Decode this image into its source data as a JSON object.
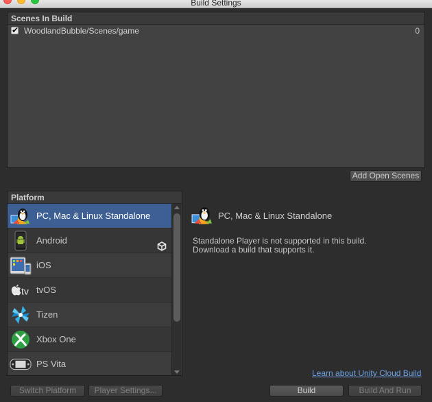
{
  "window": {
    "title": "Build Settings"
  },
  "scenes": {
    "header": "Scenes In Build",
    "items": [
      {
        "path": "WoodlandBubble/Scenes/game",
        "index": "0",
        "checked": true
      }
    ],
    "add_open_scenes_label": "Add Open Scenes"
  },
  "platform": {
    "header": "Platform",
    "items": [
      {
        "label": "PC, Mac & Linux Standalone",
        "icon": "linux-penguin-icon",
        "selected": true
      },
      {
        "label": "Android",
        "icon": "android-icon",
        "selected": false,
        "badge": "unity-logo-icon"
      },
      {
        "label": "iOS",
        "icon": "ios-devices-icon",
        "selected": false
      },
      {
        "label": "tvOS",
        "icon": "apple-tv-icon",
        "selected": false
      },
      {
        "label": "Tizen",
        "icon": "tizen-icon",
        "selected": false
      },
      {
        "label": "Xbox One",
        "icon": "xbox-icon",
        "selected": false
      },
      {
        "label": "PS Vita",
        "icon": "ps-vita-icon",
        "selected": false
      }
    ]
  },
  "detail": {
    "title": "PC, Mac & Linux Standalone",
    "message_line1": "Standalone Player is not supported in this build.",
    "message_line2": "Download a build that supports it.",
    "cloud_link": "Learn about Unity Cloud Build"
  },
  "footer": {
    "switch_platform_label": "Switch Platform",
    "player_settings_label": "Player Settings...",
    "build_label": "Build",
    "build_and_run_label": "Build And Run"
  },
  "colors": {
    "background": "#2d2d2d",
    "selection": "#3d5f93",
    "link": "#6fa3e8"
  }
}
